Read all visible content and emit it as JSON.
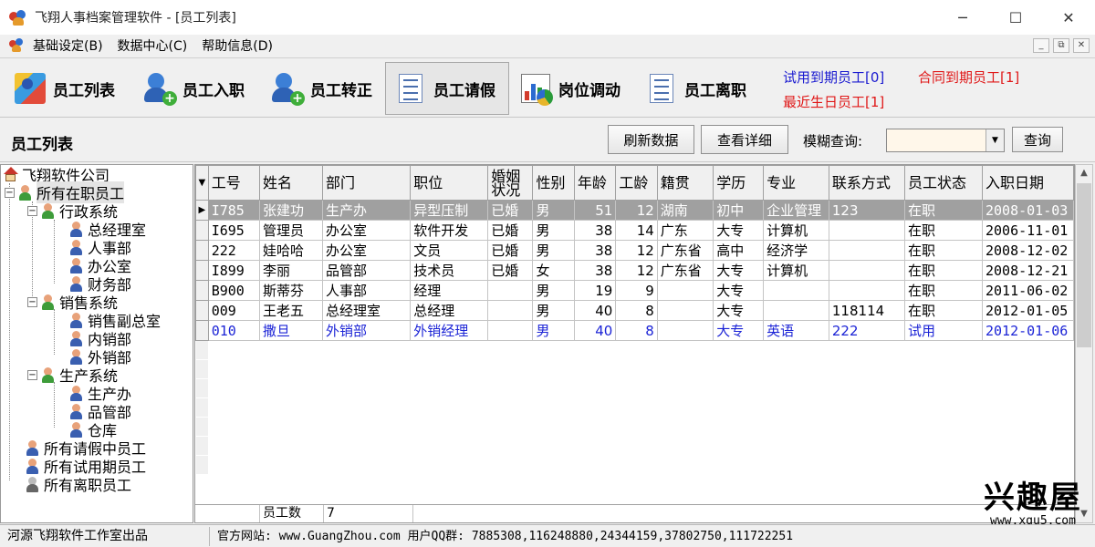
{
  "window": {
    "title": "飞翔人事档案管理软件 - [员工列表]",
    "controls": [
      "─",
      "☐",
      "✕"
    ]
  },
  "menu": [
    {
      "label": "基础设定(B)"
    },
    {
      "label": "数据中心(C)"
    },
    {
      "label": "帮助信息(D)"
    }
  ],
  "mdi_controls": [
    "_",
    "⧉",
    "✕"
  ],
  "toolbar": {
    "buttons": [
      {
        "label": "员工列表",
        "icon": "employee-list-icon"
      },
      {
        "label": "员工入职",
        "icon": "add-person-icon"
      },
      {
        "label": "员工转正",
        "icon": "add-person-icon"
      },
      {
        "label": "员工请假",
        "icon": "checklist-icon"
      },
      {
        "label": "岗位调动",
        "icon": "chart-icon"
      },
      {
        "label": "员工离职",
        "icon": "checklist-icon"
      }
    ],
    "active_index": 3,
    "alerts": {
      "probation": {
        "text": "试用到期员工[0]",
        "color": "#1a1ad0"
      },
      "contract": {
        "text": "合同到期员工[1]",
        "color": "#e01818"
      },
      "birthday": {
        "text": "最近生日员工[1]",
        "color": "#e01818"
      }
    }
  },
  "section": {
    "title": "员工列表",
    "refresh_label": "刷新数据",
    "detail_label": "查看详细",
    "search_label": "模糊查询:",
    "search_value": "",
    "query_label": "查询"
  },
  "tree": {
    "root": "飞翔软件公司",
    "all_active": "所有在职员工",
    "groups": [
      {
        "label": "行政系统",
        "children": [
          "总经理室",
          "人事部",
          "办公室",
          "财务部"
        ]
      },
      {
        "label": "销售系统",
        "children": [
          "销售副总室",
          "内销部",
          "外销部"
        ]
      },
      {
        "label": "生产系统",
        "children": [
          "生产办",
          "品管部",
          "仓库"
        ]
      }
    ],
    "others": [
      "所有请假中员工",
      "所有试用期员工",
      "所有离职员工"
    ]
  },
  "grid": {
    "columns": [
      "工号",
      "姓名",
      "部门",
      "职位",
      "婚姻\n状况",
      "性别",
      "年龄",
      "工龄",
      "籍贯",
      "学历",
      "专业",
      "联系方式",
      "员工状态",
      "入职日期"
    ],
    "rows": [
      [
        "I785",
        "张建功",
        "生产办",
        "异型压制",
        "已婚",
        "男",
        "51",
        "12",
        "湖南",
        "初中",
        "企业管理",
        "123",
        "在职",
        "2008-01-03"
      ],
      [
        "I695",
        "管理员",
        "办公室",
        "软件开发",
        "已婚",
        "男",
        "38",
        "14",
        "广东",
        "大专",
        "计算机",
        "",
        "在职",
        "2006-11-01"
      ],
      [
        "222",
        "娃哈哈",
        "办公室",
        "文员",
        "已婚",
        "男",
        "38",
        "12",
        "广东省",
        "高中",
        "经济学",
        "",
        "在职",
        "2008-12-02"
      ],
      [
        "I899",
        "李丽",
        "品管部",
        "技术员",
        "已婚",
        "女",
        "38",
        "12",
        "广东省",
        "大专",
        "计算机",
        "",
        "在职",
        "2008-12-21"
      ],
      [
        "B900",
        "斯蒂芬",
        "人事部",
        "经理",
        "",
        "男",
        "19",
        "9",
        "",
        "大专",
        "",
        "",
        "在职",
        "2011-06-02"
      ],
      [
        "009",
        "王老五",
        "总经理室",
        "总经理",
        "",
        "男",
        "40",
        "8",
        "",
        "大专",
        "",
        "118114",
        "在职",
        "2012-01-05"
      ],
      [
        "010",
        "撒旦",
        "外销部",
        "外销经理",
        "",
        "男",
        "40",
        "8",
        "",
        "大专",
        "英语",
        "222",
        "试用",
        "2012-01-06"
      ]
    ],
    "selected_row": 0,
    "highlight_row": 6,
    "footer_label": "员工数",
    "footer_count": "7"
  },
  "status": {
    "left": "河源飞翔软件工作室出品",
    "right": "官方网站: www.GuangZhou.com 用户QQ群: 7885308,116248880,24344159,37802750,111722251"
  },
  "watermark": {
    "logo": "兴趣屋",
    "url": "www.xqu5.com"
  }
}
